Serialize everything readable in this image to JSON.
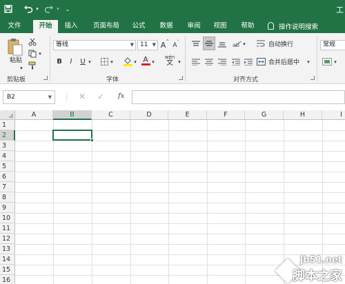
{
  "titlebar": {
    "right_text": "工"
  },
  "tabs": [
    {
      "label": "文件"
    },
    {
      "label": "开始"
    },
    {
      "label": "插入"
    },
    {
      "label": "页面布局"
    },
    {
      "label": "公式"
    },
    {
      "label": "数据"
    },
    {
      "label": "审阅"
    },
    {
      "label": "视图"
    },
    {
      "label": "帮助"
    }
  ],
  "tell_me": "操作说明搜索",
  "ribbon": {
    "clipboard": {
      "paste_label": "粘贴",
      "group_label": "剪贴板"
    },
    "font": {
      "font_name": "等线",
      "font_size": "11",
      "grow": "A",
      "shrink": "A",
      "bold": "B",
      "italic": "I",
      "underline": "U",
      "font_color_letter": "A",
      "phonetic": "wén",
      "group_label": "字体"
    },
    "alignment": {
      "wrap_text": "自动换行",
      "merge_center": "合并后居中",
      "group_label": "对齐方式"
    },
    "number": {
      "format": "常规"
    }
  },
  "formula_bar": {
    "name_box": "B2",
    "cancel": "✕",
    "enter": "✓",
    "fx": "fx",
    "value": ""
  },
  "sheet": {
    "columns": [
      "A",
      "B",
      "C",
      "D",
      "E",
      "F",
      "G",
      "H",
      "I"
    ],
    "rows": [
      "1",
      "2",
      "3",
      "4",
      "5",
      "6",
      "7",
      "8",
      "9",
      "10",
      "11",
      "12",
      "13",
      "14",
      "15",
      "16"
    ],
    "selected_column": "B",
    "selected_row": "2"
  },
  "watermark": {
    "site": "jb51.net",
    "name": "脚本之家"
  },
  "colors": {
    "excel_green": "#217346",
    "ribbon_bg": "#f3f3f3"
  }
}
